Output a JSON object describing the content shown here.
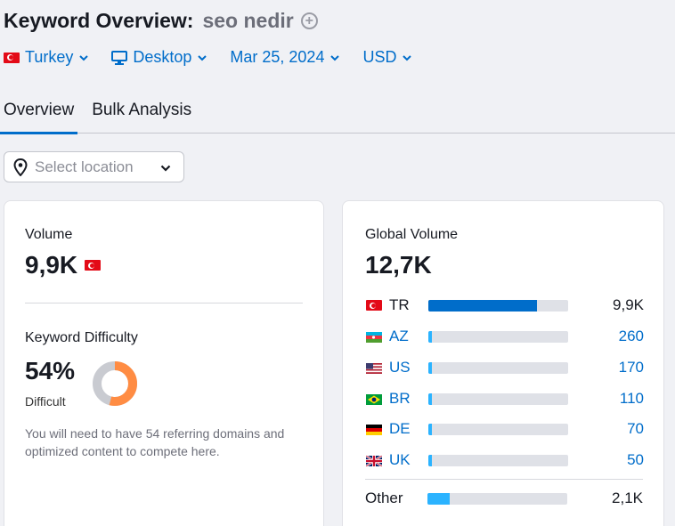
{
  "header": {
    "title": "Keyword Overview:",
    "keyword": "seo nedir"
  },
  "filters": {
    "country": "Turkey",
    "device": "Desktop",
    "date": "Mar 25, 2024",
    "currency": "USD"
  },
  "tabs": [
    {
      "label": "Overview"
    },
    {
      "label": "Bulk Analysis"
    }
  ],
  "location": {
    "placeholder": "Select location"
  },
  "volume": {
    "label": "Volume",
    "value": "9,9K"
  },
  "difficulty": {
    "label": "Keyword Difficulty",
    "value": "54%",
    "level": "Difficult",
    "percent": 54,
    "description": "You will need to have 54 referring domains and optimized content to compete here."
  },
  "global": {
    "label": "Global Volume",
    "value": "12,7K",
    "rows": [
      {
        "code": "TR",
        "value": "9,9K",
        "fraction": 0.78,
        "flag": "turkey-flag-icon"
      },
      {
        "code": "AZ",
        "value": "260",
        "fraction": 0.02,
        "flag": "azerbaijan-flag-icon"
      },
      {
        "code": "US",
        "value": "170",
        "fraction": 0.015,
        "flag": "usa-flag-icon"
      },
      {
        "code": "BR",
        "value": "110",
        "fraction": 0.012,
        "flag": "brazil-flag-icon"
      },
      {
        "code": "DE",
        "value": "70",
        "fraction": 0.01,
        "flag": "germany-flag-icon"
      },
      {
        "code": "UK",
        "value": "50",
        "fraction": 0.01,
        "flag": "uk-flag-icon"
      }
    ],
    "other": {
      "label": "Other",
      "value": "2,1K",
      "fraction": 0.16
    }
  },
  "colors": {
    "accent": "#006dca",
    "bar_primary": "#006dca",
    "bar_secondary": "#2bb3ff",
    "difficulty": "#ff8c43"
  }
}
